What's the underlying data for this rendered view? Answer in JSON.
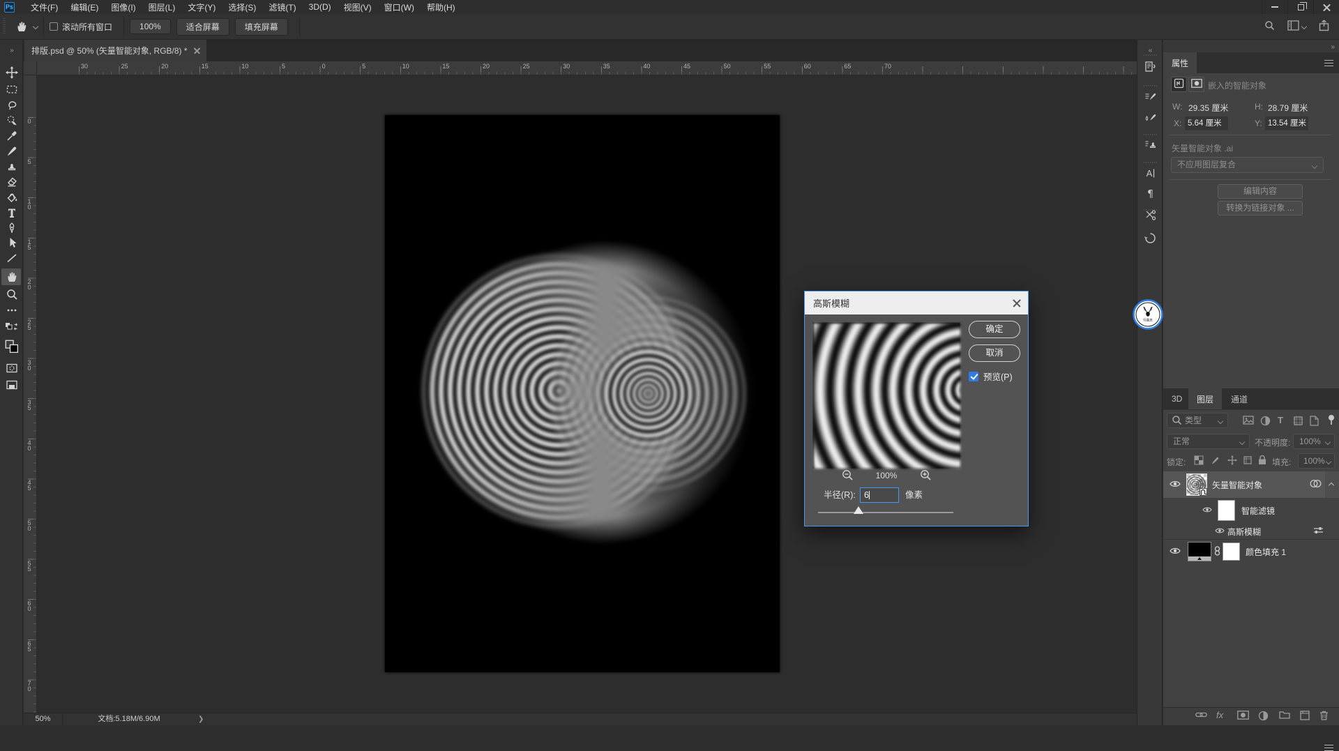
{
  "menu": {
    "logo": "Ps",
    "items": [
      "文件(F)",
      "编辑(E)",
      "图像(I)",
      "图层(L)",
      "文字(Y)",
      "选择(S)",
      "滤镜(T)",
      "3D(D)",
      "视图(V)",
      "窗口(W)",
      "帮助(H)"
    ]
  },
  "options": {
    "scroll_all_windows": "滚动所有窗口",
    "zoom_100": "100%",
    "fit_screen": "适合屏幕",
    "fill_screen": "填充屏幕"
  },
  "tab": {
    "title": "排版.psd @ 50% (矢量智能对象, RGB/8) *"
  },
  "rulers": {
    "h_labels": [
      "30",
      "25",
      "20",
      "15",
      "10",
      "5",
      "0",
      "5",
      "10",
      "15",
      "20",
      "25",
      "30",
      "35",
      "40",
      "45",
      "50",
      "55",
      "60",
      "65",
      "70"
    ],
    "v_labels": [
      "0",
      "5",
      "10",
      "15",
      "20",
      "25",
      "30",
      "35",
      "40",
      "45",
      "50",
      "55",
      "60",
      "65",
      "70"
    ]
  },
  "dialog": {
    "title": "高斯模糊",
    "ok": "确定",
    "cancel": "取消",
    "preview_label": "预览(P)",
    "zoom_level": "100%",
    "radius_label": "半径(R):",
    "radius_value": "6",
    "unit": "像素"
  },
  "properties": {
    "tab": "属性",
    "object_type": "嵌入的智能对象",
    "w_label": "W:",
    "w_value": "29.35",
    "h_label": "H:",
    "h_value": "28.79",
    "x_label": "X:",
    "x_value": "5.64",
    "y_label": "Y:",
    "y_value": "13.54",
    "unit": "厘米",
    "source_name": "矢量智能对象 .ai",
    "layer_comp": "不应用图层复合",
    "edit_content": "编辑内容",
    "convert_linked": "转换为链接对象 ..."
  },
  "layers": {
    "tabs": [
      "3D",
      "图层",
      "通道"
    ],
    "active_tab": "图层",
    "filter_label": "类型",
    "blend_mode": "正常",
    "opacity_label": "不透明度:",
    "opacity_value": "100%",
    "lock_label": "锁定:",
    "fill_label": "填充:",
    "fill_value": "100%",
    "layer1": "矢量智能对象",
    "smart_filter": "智能滤镜",
    "gaussian_blur": "高斯模糊",
    "layer2": "颜色填充 1"
  },
  "status": {
    "zoom": "50%",
    "doc_info": "文档:5.18M/6.90M"
  },
  "badge": {
    "text": "行森志"
  }
}
